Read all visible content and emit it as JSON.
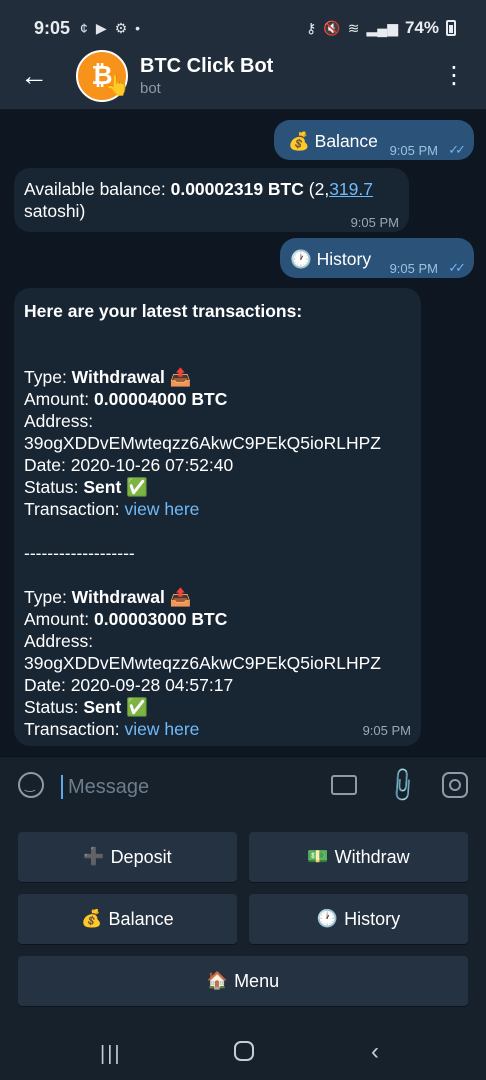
{
  "status_bar": {
    "time": "9:05",
    "notif_icons": [
      "¢",
      "▶",
      "⚙",
      "•"
    ],
    "battery_percent": "74%"
  },
  "header": {
    "title": "BTC Click Bot",
    "subtitle": "bot",
    "avatar_symbol": "₿"
  },
  "messages": {
    "balance_cmd": {
      "text": "💰 Balance",
      "time": "9:05 PM"
    },
    "available": {
      "prefix": "Available balance: ",
      "amount": "0.00002319 BTC",
      "paren_open": " (2,",
      "satoshi_link": "319.7",
      "line2": "satoshi)",
      "time": "9:05 PM"
    },
    "history_cmd": {
      "text": "🕐 History",
      "time": "9:05 PM"
    },
    "transactions": {
      "header": "Here are your latest transactions:",
      "separator": "-------------------",
      "time": "9:05 PM",
      "labels": {
        "type": "Type: ",
        "amount": "Amount: ",
        "address": "Address:",
        "status": "Status: ",
        "transaction": "Transaction: "
      },
      "items": [
        {
          "type": "Withdrawal 📤",
          "amount": "0.00004000 BTC",
          "address": "39ogXDDvEMwteqzz6AkwC9PEkQ5ioRLHPZ",
          "date": "Date: 2020-10-26 07:52:40",
          "status": "Sent ✅",
          "link": "view here"
        },
        {
          "type": "Withdrawal 📤",
          "amount": "0.00003000 BTC",
          "address": "39ogXDDvEMwteqzz6AkwC9PEkQ5ioRLHPZ",
          "date": "Date: 2020-09-28 04:57:17",
          "status": "Sent ✅",
          "link": "view here"
        }
      ]
    }
  },
  "composer": {
    "placeholder": "Message"
  },
  "keyboard": {
    "deposit": {
      "icon": "➕",
      "label": "Deposit"
    },
    "withdraw": {
      "icon": "💵",
      "label": "Withdraw"
    },
    "balance": {
      "icon": "💰",
      "label": "Balance"
    },
    "history": {
      "icon": "🕐",
      "label": "History"
    },
    "menu": {
      "icon": "🏠",
      "label": "Menu"
    }
  },
  "navbar": {
    "recent": "|||",
    "back": "‹"
  }
}
